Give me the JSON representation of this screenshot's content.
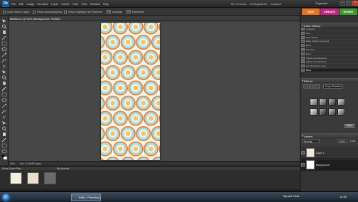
{
  "app": {
    "logo_text": "Pe",
    "menu": [
      "File",
      "Edit",
      "Image",
      "Enhance",
      "Layer",
      "Select",
      "Filter",
      "View",
      "Window",
      "Help"
    ],
    "menu_right": [
      "My Products",
      "Gettingstarted",
      "Collapse"
    ],
    "organizer_label": "Organizer"
  },
  "options_bar": {
    "items": [
      "Auto Select Layer",
      "Show Bounding Box",
      "Show Highlight on Rollover",
      "Arrange",
      "Distribute"
    ]
  },
  "mode_tabs": [
    {
      "label": "EDIT",
      "color": "#e8731f"
    },
    {
      "label": "CREATE",
      "color": "#c0257f"
    },
    {
      "label": "SHARE",
      "color": "#3f9a2e"
    }
  ],
  "document": {
    "tab_title": "Untitled-1 @ 50% (Background, RGB/8)",
    "close_glyph": "×",
    "pattern_colors": {
      "outer_ring": "#e87a2a",
      "fill": "#a8dde3",
      "inner_ring": "#f7f2e8",
      "center": "#f3c562",
      "background": "#f7f2e8"
    }
  },
  "status_bar": {
    "zoom": "50%",
    "doc_info": "Doc: 3.00M/0 bytes"
  },
  "project_bin": {
    "label": "Show Open Files",
    "bin_actions": "Bin Actions"
  },
  "panels": {
    "undo_history": {
      "title": "Undo History",
      "items": [
        "Untitled-1",
        "New",
        "Paint Bucket",
        "Make Pattern Document",
        "Move",
        "Fill Layer",
        "Move",
        "Adjust Hue/Saturation",
        "Adjust Hue/Saturation",
        "Grid Transform Layer",
        "Move"
      ],
      "active_index": 10
    },
    "effects": {
      "title": "Effects",
      "category": "Drop Shadows",
      "apply_label": "Apply"
    },
    "layers": {
      "title": "Layers",
      "mode": "Normal",
      "opacity": "100%",
      "lock_label": "Lock",
      "items": [
        {
          "name": "Layer 1"
        },
        {
          "name": "Background"
        }
      ]
    }
  },
  "taskbar": {
    "app_label": "Editor - Photoshop...",
    "tray_text": "Tips and Tricks",
    "clock": "11:45"
  }
}
